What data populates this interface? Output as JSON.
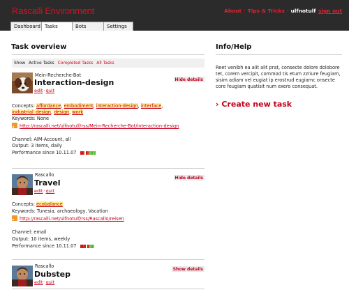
{
  "app": {
    "title": "Rascalli Environment",
    "nav": {
      "about": "About",
      "separator": "·",
      "tips": "Tips & Tricks",
      "user": "ulfnotulf",
      "signout": "sign out"
    },
    "tabs": [
      "Dashboard",
      "Tasks",
      "Bots",
      "Settings"
    ],
    "active_tab": "Tasks"
  },
  "main": {
    "title": "Task overview",
    "filter": {
      "label": "Show",
      "options": [
        "Active Tasks",
        "Completed Tasks",
        "All Tasks"
      ],
      "active": "Active Tasks"
    },
    "tasks": [
      {
        "bot": "Mein-Recherche-Bot",
        "name": "Interaction-design",
        "edit": "edit",
        "quit": "quit",
        "toggle": "Hide details",
        "concepts_label": "Concepts:",
        "concepts": [
          "affordance",
          "embodiment",
          "interaction-design",
          "interface",
          "industrial_design",
          "design",
          "work"
        ],
        "keywords": "Keywords: None",
        "rss": "http://rascalli.net/ulfnotulf/rss/Mein-Recherche-Bot/interaction-design",
        "channel": "Channel: AIM-Account, all",
        "output": "Output: 3 items, daily",
        "performance": "Performance since 10.11.07"
      },
      {
        "bot": "Rascallo",
        "name": "Travel",
        "edit": "edit",
        "quit": "quit",
        "toggle": "Hide details",
        "concepts_label": "Concepts:",
        "concepts": [
          "ecobalance"
        ],
        "keywords": "Keywords: Tunesia, archaeology, Vacation",
        "rss": "http://rascalli.net/ulfnotulf/rss/Rascallo/reisen",
        "channel": "Channel: email",
        "output": "Output: 10 items, weekly",
        "performance": "Performance since 10.11.07"
      },
      {
        "bot": "Rascallo",
        "name": "Dubstep",
        "edit": "edit",
        "quit": "quit",
        "toggle": "Show details"
      }
    ]
  },
  "side": {
    "title": "Info/Help",
    "text": "Reet venibh ea alit alit prat, consecte dolore dolobore tet, corem vercipit, commod tis etum zzriure feugiam, sisim adiam vel eugiat ip erostrud eugiamc onsecte core feugiam quatisit num exero consequat.",
    "create": "› Create new task"
  },
  "colors": {
    "accent": "#d80f20",
    "header_bg": "#2b2b2b",
    "highlight": "#fff18e",
    "rss": "#f4972a"
  }
}
